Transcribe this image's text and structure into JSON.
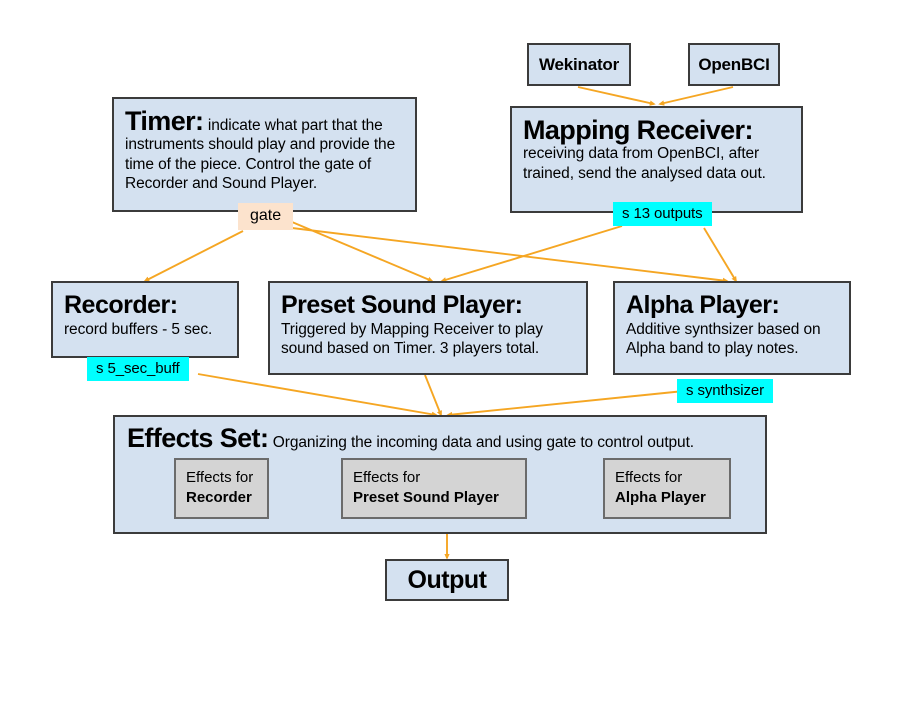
{
  "diagram": {
    "title_hidden": "Audio system signal flow diagram",
    "colors": {
      "node_fill": "#d4e1f0",
      "node_border": "#3b3b3b",
      "badge_fill": "#00ffff",
      "gate_fill": "#fce3cd",
      "arrow": "#f5a623",
      "effect_fill": "#d4d4d4",
      "effect_border": "#6b6b6b",
      "background": "#ffffff"
    },
    "nodes": {
      "wekinator": {
        "label": "Wekinator"
      },
      "openbci": {
        "label": "OpenBCI"
      },
      "timer": {
        "title": "Timer:",
        "desc": "indicate what part that the instruments should play and provide the time of the piece. Control the gate of Recorder and Sound Player."
      },
      "mapping_receiver": {
        "title": "Mapping Receiver:",
        "desc_line1": "receiving data from OpenBCI, after",
        "desc_line2": "trained, send the analysed data out."
      },
      "recorder": {
        "title": "Recorder:",
        "desc": "record buffers - 5 sec."
      },
      "preset_sound_player": {
        "title": "Preset Sound Player:",
        "desc_line1": "Triggered by Mapping Receiver to play",
        "desc_line2": "sound based on Timer. 3 players total."
      },
      "alpha_player": {
        "title": "Alpha Player:",
        "desc_line1": "Additive synthsizer based on",
        "desc_line2": "Alpha band to play notes."
      },
      "effects_set": {
        "title": "Effects Set:",
        "desc": "Organizing the incoming data and using gate to control output.",
        "inner": [
          {
            "line1": "Effects for",
            "line2": "Recorder"
          },
          {
            "line1": "Effects for",
            "line2": "Preset Sound Player"
          },
          {
            "line1": "Effects for",
            "line2": "Alpha Player"
          }
        ]
      },
      "output": {
        "label": "Output"
      }
    },
    "labels": {
      "gate": "gate",
      "badge_outputs": "s 13 outputs",
      "badge_buffer": "s 5_sec_buff",
      "badge_synth": "s synthsizer"
    }
  }
}
